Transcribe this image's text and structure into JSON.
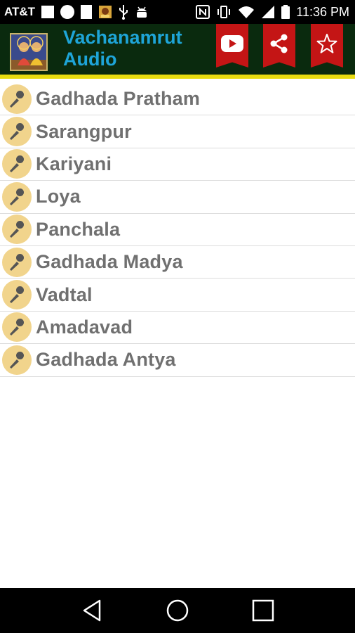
{
  "status_bar": {
    "carrier": "AT&T",
    "time": "11:36 PM"
  },
  "app_bar": {
    "title": "Vachanamrut\nAudio",
    "actions": [
      {
        "name": "youtube-icon"
      },
      {
        "name": "share-icon"
      },
      {
        "name": "star-icon"
      }
    ],
    "colors": {
      "background": "#0a2a0e",
      "title": "#1ea5d8",
      "ribbon": "#c41515",
      "underline": "#e8dc10"
    }
  },
  "list": {
    "items": [
      {
        "label": "Gadhada Pratham",
        "icon": "microphone-icon"
      },
      {
        "label": "Sarangpur",
        "icon": "microphone-icon"
      },
      {
        "label": "Kariyani",
        "icon": "microphone-icon"
      },
      {
        "label": "Loya",
        "icon": "microphone-icon"
      },
      {
        "label": "Panchala",
        "icon": "microphone-icon"
      },
      {
        "label": "Gadhada Madya",
        "icon": "microphone-icon"
      },
      {
        "label": "Vadtal",
        "icon": "microphone-icon"
      },
      {
        "label": "Amadavad",
        "icon": "microphone-icon"
      },
      {
        "label": "Gadhada Antya",
        "icon": "microphone-icon"
      }
    ]
  },
  "nav_bar": {
    "buttons": [
      "back-icon",
      "home-icon",
      "recents-icon"
    ]
  }
}
